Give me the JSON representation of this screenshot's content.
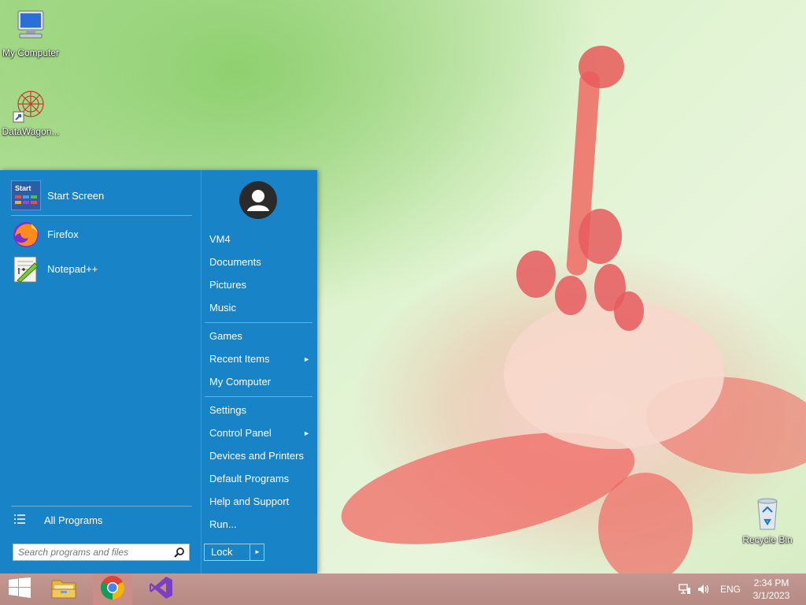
{
  "desktop": {
    "icons": [
      {
        "label": "My Computer"
      },
      {
        "label": "DataWagon..."
      },
      {
        "label": "Recycle Bin"
      }
    ]
  },
  "start_menu": {
    "pinned": [
      {
        "label": "Start Screen",
        "tile_text": "Start"
      },
      {
        "label": "Firefox"
      },
      {
        "label": "Notepad++"
      }
    ],
    "all_programs_label": "All Programs",
    "search": {
      "placeholder": "Search programs and files",
      "value": ""
    },
    "right": {
      "items": [
        {
          "label": "VM4"
        },
        {
          "label": "Documents"
        },
        {
          "label": "Pictures"
        },
        {
          "label": "Music"
        },
        {
          "label": "Games"
        },
        {
          "label": "Recent Items",
          "submenu_arrow": "►"
        },
        {
          "label": "My Computer"
        },
        {
          "label": "Settings"
        },
        {
          "label": "Control Panel",
          "submenu_arrow": "►"
        },
        {
          "label": "Devices and Printers"
        },
        {
          "label": "Default Programs"
        },
        {
          "label": "Help and Support"
        },
        {
          "label": "Run..."
        }
      ],
      "lock_label": "Lock",
      "lock_arrow": "►"
    }
  },
  "taskbar": {
    "apps": [
      {
        "icon": "windows-start-icon"
      },
      {
        "icon": "file-explorer-icon"
      },
      {
        "icon": "chrome-icon"
      },
      {
        "icon": "visual-studio-icon"
      }
    ],
    "tray": {
      "language": "ENG",
      "time": "2:34 PM",
      "date": "3/1/2023"
    }
  },
  "colors": {
    "menu_bg": "#1883c6",
    "taskbar_bg": "#bb8f88",
    "chrome_active_bg": "#c98e87"
  }
}
